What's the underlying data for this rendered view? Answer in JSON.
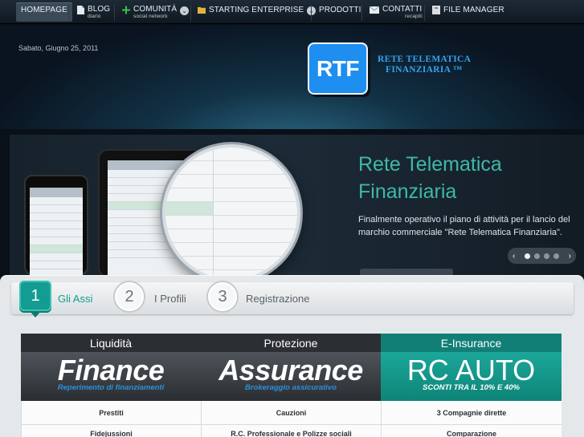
{
  "nav": {
    "items": [
      {
        "label": "HOMEPAGE",
        "sub": ""
      },
      {
        "label": "BLOG",
        "sub": "diario"
      },
      {
        "label": "COMUNITÀ",
        "sub": "social network"
      },
      {
        "label": "STARTING ENTERPRISE",
        "sub": ""
      },
      {
        "label": "PRODOTTI",
        "sub": ""
      },
      {
        "label": "CONTATTI",
        "sub": "recapiti"
      },
      {
        "label": "FILE MANAGER",
        "sub": ""
      }
    ],
    "icons": [
      "document-icon",
      "plus-icon",
      "folder-icon",
      "envelope-icon",
      "archive-icon"
    ]
  },
  "header": {
    "date": "Sabato, Giugno 25, 2011",
    "logo_letters": "RTF",
    "logo_line1": "RETE TELEMATICA",
    "logo_line2": "FINANZIARIA ™"
  },
  "slider": {
    "title_line1": "Rete Telematica",
    "title_line2": "Finanziaria",
    "text": "Finalmente operativo il piano di attività per il lancio del marchio commerciale \"Rete Telematica Finanziaria\".",
    "prev": "‹",
    "next": "›",
    "slide_count": 4,
    "active_slide": 1
  },
  "steps": [
    {
      "num": "1",
      "label": "Gli Assi"
    },
    {
      "num": "2",
      "label": "I Profili"
    },
    {
      "num": "3",
      "label": "Registrazione"
    }
  ],
  "columns": [
    {
      "head": "Liquidità",
      "big": "Finance",
      "sub": "Reperimento di finanziamenti",
      "row1": "Prestiti",
      "row2": "Fidejussioni"
    },
    {
      "head": "Protezione",
      "big": "Assurance",
      "sub": "Brokeraggio assicurativo",
      "row1": "Cauzioni",
      "row2": "R.C. Professionale e Polizze sociali"
    },
    {
      "head": "E-Insurance",
      "big": "RC AUTO",
      "sub": "SCONTI TRA IL 10% E 40%",
      "row1": "3 Compagnie dirette",
      "row2": "Comparazione"
    }
  ],
  "colors": {
    "accent": "#139d92",
    "logo_blue": "#1e8ef0",
    "title_teal": "#3fb8a8"
  }
}
